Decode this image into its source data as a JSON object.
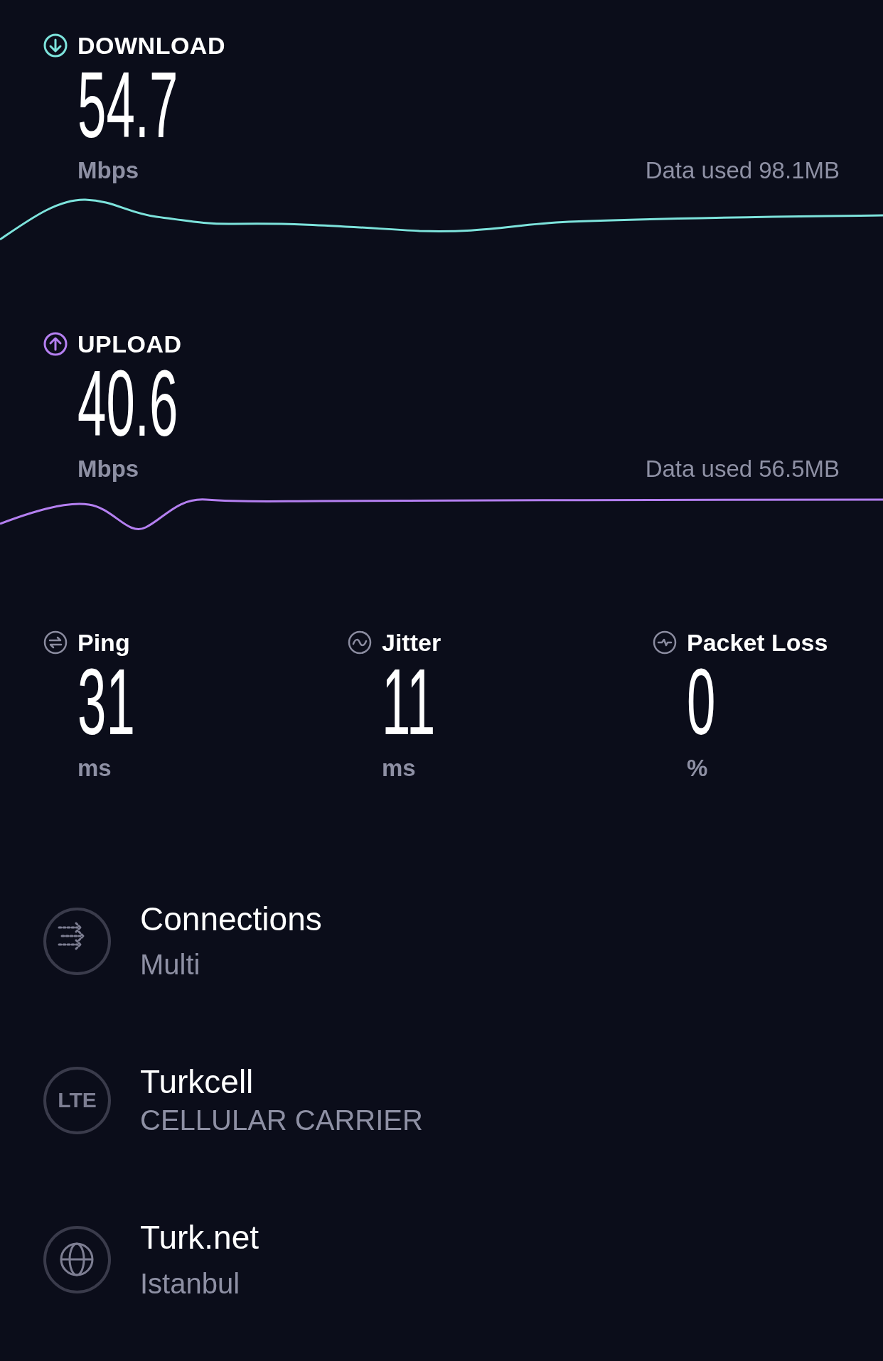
{
  "tests": [
    {
      "kind": "download",
      "label": "DOWNLOAD",
      "value": "54.7",
      "unit": "Mbps",
      "data_used": "Data used 98.1MB",
      "color": "#7de3dc"
    },
    {
      "kind": "upload",
      "label": "UPLOAD",
      "value": "40.6",
      "unit": "Mbps",
      "data_used": "Data used 56.5MB",
      "color": "#b47ff0"
    }
  ],
  "metrics": [
    {
      "kind": "ping",
      "label": "Ping",
      "value": "31",
      "unit": "ms"
    },
    {
      "kind": "jitter",
      "label": "Jitter",
      "value": "11",
      "unit": "ms"
    },
    {
      "kind": "packet_loss",
      "label": "Packet Loss",
      "value": "0",
      "unit": "%"
    }
  ],
  "info": [
    {
      "kind": "connections",
      "title": "Connections",
      "subtitle": "Multi"
    },
    {
      "kind": "carrier",
      "title": "Turkcell",
      "subtitle": "CELLULAR CARRIER",
      "icon_text": "LTE"
    },
    {
      "kind": "server",
      "title": "Turk.net",
      "subtitle": "Istanbul"
    }
  ]
}
